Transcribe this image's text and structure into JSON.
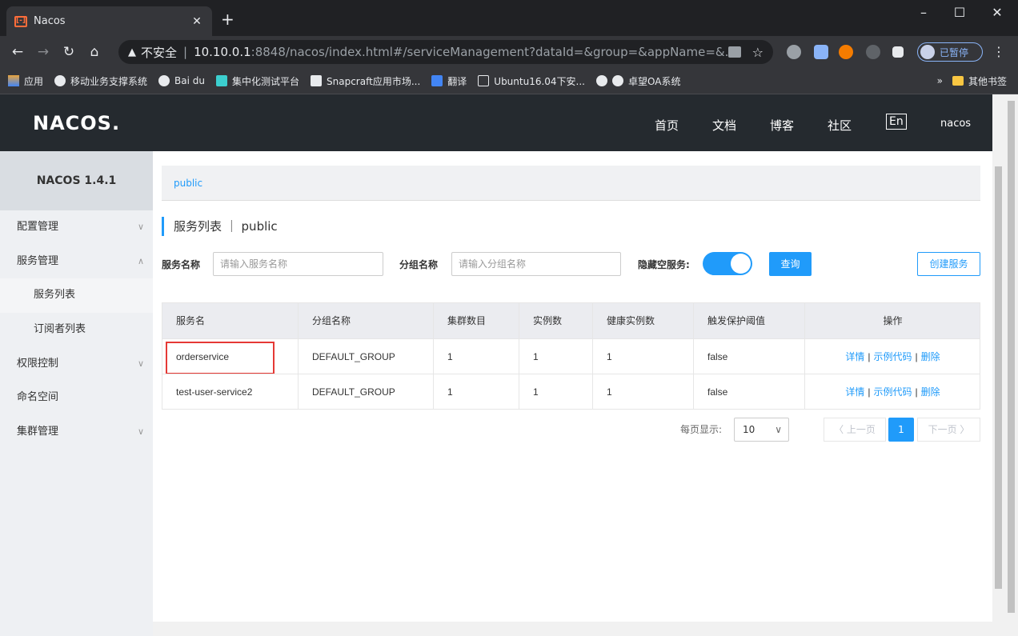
{
  "browser": {
    "tab_title": "Nacos",
    "tab_icon": "[-]",
    "new_tab": "+",
    "security_label": "不安全",
    "url_host": "10.10.0.1",
    "url_rest": ":8848/nacos/index.html#/serviceManagement?dataId=&group=&appName=&...",
    "paused_label": "已暂停",
    "bookmarks": [
      "应用",
      "移动业务支撑系统",
      "Bai du",
      "集中化测试平台",
      "Snapcraft应用市场...",
      "翻译",
      "Ubuntu16.04下安...",
      "卓望OA系统"
    ],
    "bookmarks_more": "»",
    "other_bookmarks": "其他书签"
  },
  "header": {
    "logo": "NACOS.",
    "nav": [
      "首页",
      "文档",
      "博客",
      "社区"
    ],
    "lang": "En",
    "user": "nacos"
  },
  "sidebar": {
    "version": "NACOS 1.4.1",
    "items": [
      {
        "label": "配置管理",
        "chevron": "∨"
      },
      {
        "label": "服务管理",
        "chevron": "∧"
      },
      {
        "label": "服务列表",
        "chevron": ""
      },
      {
        "label": "订阅者列表",
        "chevron": ""
      },
      {
        "label": "权限控制",
        "chevron": "∨"
      },
      {
        "label": "命名空间",
        "chevron": ""
      },
      {
        "label": "集群管理",
        "chevron": "∨"
      }
    ]
  },
  "main": {
    "breadcrumb": "public",
    "title": "服务列表 ｜ public",
    "filters": {
      "service_label": "服务名称",
      "service_placeholder": "请输入服务名称",
      "group_label": "分组名称",
      "group_placeholder": "请输入分组名称",
      "hide_empty_label": "隐藏空服务:",
      "hide_empty_on": true,
      "query_button": "查询",
      "create_button": "创建服务"
    },
    "table": {
      "columns": [
        "服务名",
        "分组名称",
        "集群数目",
        "实例数",
        "健康实例数",
        "触发保护阈值",
        "操作"
      ],
      "rows": [
        {
          "name": "orderservice",
          "group": "DEFAULT_GROUP",
          "clusters": "1",
          "instances": "1",
          "healthy": "1",
          "threshold": "false"
        },
        {
          "name": "test-user-service2",
          "group": "DEFAULT_GROUP",
          "clusters": "1",
          "instances": "1",
          "healthy": "1",
          "threshold": "false"
        }
      ],
      "actions": {
        "detail": "详情",
        "sample": "示例代码",
        "delete": "删除",
        "separator": "|"
      }
    },
    "pagination": {
      "page_size_label": "每页显示:",
      "page_size": "10",
      "prev": "〈 上一页",
      "current_page": "1",
      "next": "下一页 〉"
    }
  },
  "colors": {
    "accent": "#209bfa",
    "header_bg": "#252a2f",
    "highlight": "#e53935"
  }
}
